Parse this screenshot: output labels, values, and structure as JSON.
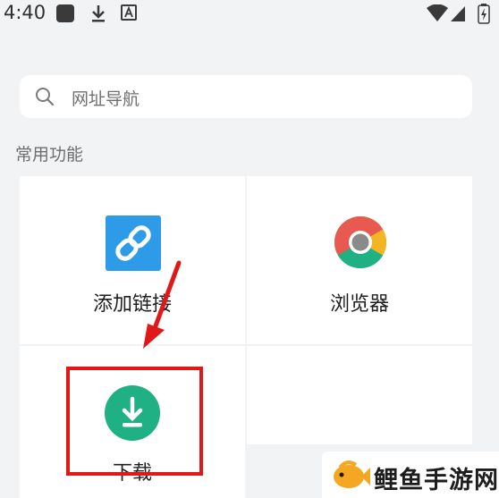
{
  "status_bar": {
    "time": "4:40",
    "icons": [
      "square-notification-icon",
      "download-icon",
      "a-box-icon",
      "wifi-icon",
      "signal-icon",
      "battery-icon"
    ]
  },
  "search": {
    "placeholder": "网址导航"
  },
  "section": {
    "title": "常用功能"
  },
  "features": [
    {
      "label": "添加链接",
      "icon": "link-icon",
      "color": "#2e9be8"
    },
    {
      "label": "浏览器",
      "icon": "chrome-icon",
      "color": "#e85a4f"
    },
    {
      "label": "下载",
      "icon": "download-circle-icon",
      "color": "#1fb083"
    }
  ],
  "annotation": {
    "color": "#e01818"
  },
  "watermark": {
    "text": "鲤鱼手游网"
  }
}
